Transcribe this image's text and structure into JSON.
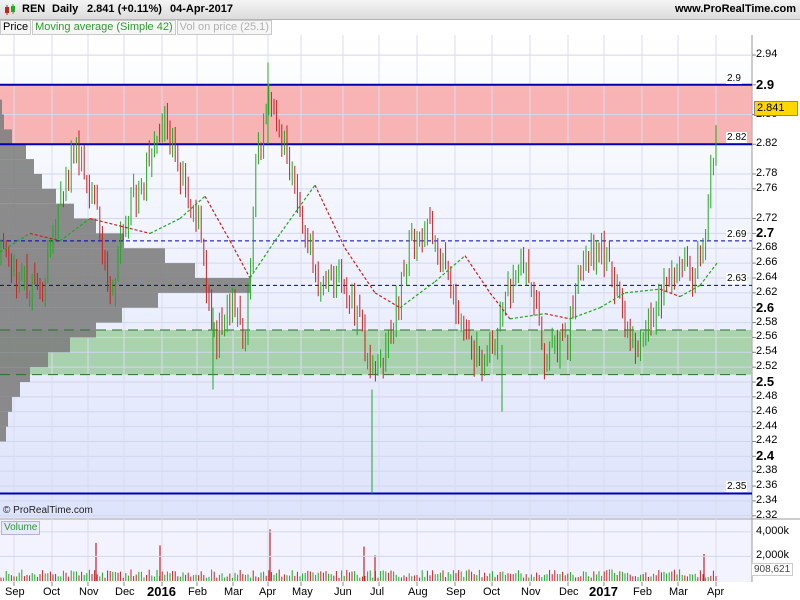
{
  "header": {
    "ticker": "REN",
    "period": "Daily",
    "quote": "2.841 (+0.11%)",
    "date": "04-Apr-2017",
    "site": "www.ProRealTime.com"
  },
  "legend": {
    "price": "Price",
    "ma": "Moving average (Simple 42)",
    "vbp": "Vol on price (25.1)"
  },
  "copyright": "© ProRealTime.com",
  "volume_label": "Volume",
  "last_price": "2.841",
  "last_volume": "908,621",
  "colors": {
    "up": "#1faa1f",
    "down": "#cc2020",
    "resistance_zone": "#f7a3a3",
    "support_zone": "#97cc99",
    "level_line": "#0000b4",
    "profile": "#7f7f7f",
    "price_badge": "#ffd700"
  },
  "chart_data": [
    {
      "type": "candlestick",
      "title": "REN Daily",
      "x_ticks": [
        "Sep",
        "Oct",
        "Nov",
        "Dec",
        "2016",
        "Feb",
        "Mar",
        "Apr",
        "May",
        "Jun",
        "Jul",
        "Aug",
        "Sep",
        "Oct",
        "Nov",
        "Dec",
        "2017",
        "Feb",
        "Mar",
        "Apr"
      ],
      "y_ticks": [
        "2.94",
        "2.9",
        "2.86",
        "2.82",
        "2.78",
        "2.76",
        "2.72",
        "2.7",
        "2.68",
        "2.66",
        "2.64",
        "2.62",
        "2.6",
        "2.58",
        "2.56",
        "2.54",
        "2.52",
        "2.5",
        "2.48",
        "2.46",
        "2.44",
        "2.42",
        "2.4",
        "2.38",
        "2.36",
        "2.34",
        "2.32"
      ],
      "ylim": [
        2.317,
        2.967
      ],
      "grid": true,
      "series": [
        {
          "name": "Price"
        },
        {
          "name": "Moving average (Simple 42)"
        },
        {
          "name": "Vol on price (25.1)"
        }
      ],
      "levels": [
        {
          "value": 2.9,
          "label": "2.9",
          "style": "solid"
        },
        {
          "value": 2.82,
          "label": "2.82",
          "style": "solid"
        },
        {
          "value": 2.69,
          "label": "2.69",
          "style": "dashed"
        },
        {
          "value": 2.63,
          "label": "2.63",
          "style": "dashed"
        },
        {
          "value": 2.35,
          "label": "2.35",
          "style": "solid"
        }
      ],
      "zones": [
        {
          "from": 2.82,
          "to": 2.9,
          "color": "#f7a3a3"
        },
        {
          "from": 2.51,
          "to": 2.57,
          "color": "#97cc99"
        }
      ],
      "close_path": [
        {
          "x": 0,
          "close": 2.67
        },
        {
          "x": 20,
          "close": 2.64
        },
        {
          "x": 40,
          "close": 2.62
        },
        {
          "x": 60,
          "close": 2.74
        },
        {
          "x": 75,
          "close": 2.82
        },
        {
          "x": 95,
          "close": 2.74
        },
        {
          "x": 110,
          "close": 2.61
        },
        {
          "x": 125,
          "close": 2.72
        },
        {
          "x": 145,
          "close": 2.78
        },
        {
          "x": 165,
          "close": 2.86
        },
        {
          "x": 185,
          "close": 2.76
        },
        {
          "x": 200,
          "close": 2.7
        },
        {
          "x": 215,
          "close": 2.55
        },
        {
          "x": 230,
          "close": 2.6
        },
        {
          "x": 245,
          "close": 2.56
        },
        {
          "x": 255,
          "close": 2.78
        },
        {
          "x": 268,
          "close": 2.9
        },
        {
          "x": 285,
          "close": 2.82
        },
        {
          "x": 300,
          "close": 2.74
        },
        {
          "x": 320,
          "close": 2.62
        },
        {
          "x": 340,
          "close": 2.64
        },
        {
          "x": 360,
          "close": 2.58
        },
        {
          "x": 375,
          "close": 2.49
        },
        {
          "x": 390,
          "close": 2.56
        },
        {
          "x": 410,
          "close": 2.68
        },
        {
          "x": 430,
          "close": 2.7
        },
        {
          "x": 450,
          "close": 2.63
        },
        {
          "x": 475,
          "close": 2.53
        },
        {
          "x": 495,
          "close": 2.55
        },
        {
          "x": 510,
          "close": 2.62
        },
        {
          "x": 525,
          "close": 2.66
        },
        {
          "x": 545,
          "close": 2.53
        },
        {
          "x": 565,
          "close": 2.55
        },
        {
          "x": 580,
          "close": 2.64
        },
        {
          "x": 600,
          "close": 2.69
        },
        {
          "x": 615,
          "close": 2.62
        },
        {
          "x": 630,
          "close": 2.57
        },
        {
          "x": 640,
          "close": 2.54
        },
        {
          "x": 650,
          "close": 2.59
        },
        {
          "x": 665,
          "close": 2.63
        },
        {
          "x": 680,
          "close": 2.66
        },
        {
          "x": 695,
          "close": 2.64
        },
        {
          "x": 705,
          "close": 2.7
        },
        {
          "x": 712,
          "close": 2.8
        },
        {
          "x": 717,
          "close": 2.841
        }
      ],
      "ma42": [
        {
          "x": 0,
          "v": 2.675
        },
        {
          "x": 30,
          "v": 2.7
        },
        {
          "x": 60,
          "v": 2.69
        },
        {
          "x": 90,
          "v": 2.72
        },
        {
          "x": 120,
          "v": 2.71
        },
        {
          "x": 150,
          "v": 2.7
        },
        {
          "x": 180,
          "v": 2.72
        },
        {
          "x": 205,
          "v": 2.75
        },
        {
          "x": 230,
          "v": 2.69
        },
        {
          "x": 250,
          "v": 2.64
        },
        {
          "x": 275,
          "v": 2.69
        },
        {
          "x": 315,
          "v": 2.765
        },
        {
          "x": 345,
          "v": 2.68
        },
        {
          "x": 375,
          "v": 2.62
        },
        {
          "x": 400,
          "v": 2.6
        },
        {
          "x": 435,
          "v": 2.635
        },
        {
          "x": 465,
          "v": 2.67
        },
        {
          "x": 490,
          "v": 2.62
        },
        {
          "x": 510,
          "v": 2.585
        },
        {
          "x": 545,
          "v": 2.592
        },
        {
          "x": 570,
          "v": 2.585
        },
        {
          "x": 600,
          "v": 2.6
        },
        {
          "x": 625,
          "v": 2.62
        },
        {
          "x": 660,
          "v": 2.625
        },
        {
          "x": 680,
          "v": 2.615
        },
        {
          "x": 700,
          "v": 2.63
        },
        {
          "x": 717,
          "v": 2.66
        }
      ],
      "volume_profile": [
        {
          "price": 2.87,
          "width": 2
        },
        {
          "price": 2.85,
          "width": 4
        },
        {
          "price": 2.83,
          "width": 12
        },
        {
          "price": 2.81,
          "width": 26
        },
        {
          "price": 2.79,
          "width": 34
        },
        {
          "price": 2.77,
          "width": 42
        },
        {
          "price": 2.75,
          "width": 56
        },
        {
          "price": 2.73,
          "width": 74
        },
        {
          "price": 2.71,
          "width": 96
        },
        {
          "price": 2.69,
          "width": 124
        },
        {
          "price": 2.67,
          "width": 165
        },
        {
          "price": 2.65,
          "width": 195
        },
        {
          "price": 2.63,
          "width": 250
        },
        {
          "price": 2.61,
          "width": 158
        },
        {
          "price": 2.59,
          "width": 122
        },
        {
          "price": 2.57,
          "width": 96
        },
        {
          "price": 2.55,
          "width": 70
        },
        {
          "price": 2.53,
          "width": 48
        },
        {
          "price": 2.51,
          "width": 30
        },
        {
          "price": 2.49,
          "width": 20
        },
        {
          "price": 2.47,
          "width": 12
        },
        {
          "price": 2.45,
          "width": 8
        },
        {
          "price": 2.43,
          "width": 6
        }
      ]
    },
    {
      "type": "bar",
      "title": "Volume",
      "y_ticks": [
        "4,000k",
        "2,000k"
      ],
      "ylim": [
        0,
        4800000
      ],
      "spikes": [
        {
          "x": 96,
          "value": 3100000
        },
        {
          "x": 160,
          "value": 2900000
        },
        {
          "x": 270,
          "value": 4200000
        },
        {
          "x": 364,
          "value": 2800000
        },
        {
          "x": 375,
          "value": 2100000
        },
        {
          "x": 704,
          "value": 2200000
        }
      ],
      "last_value": "908,621"
    }
  ]
}
